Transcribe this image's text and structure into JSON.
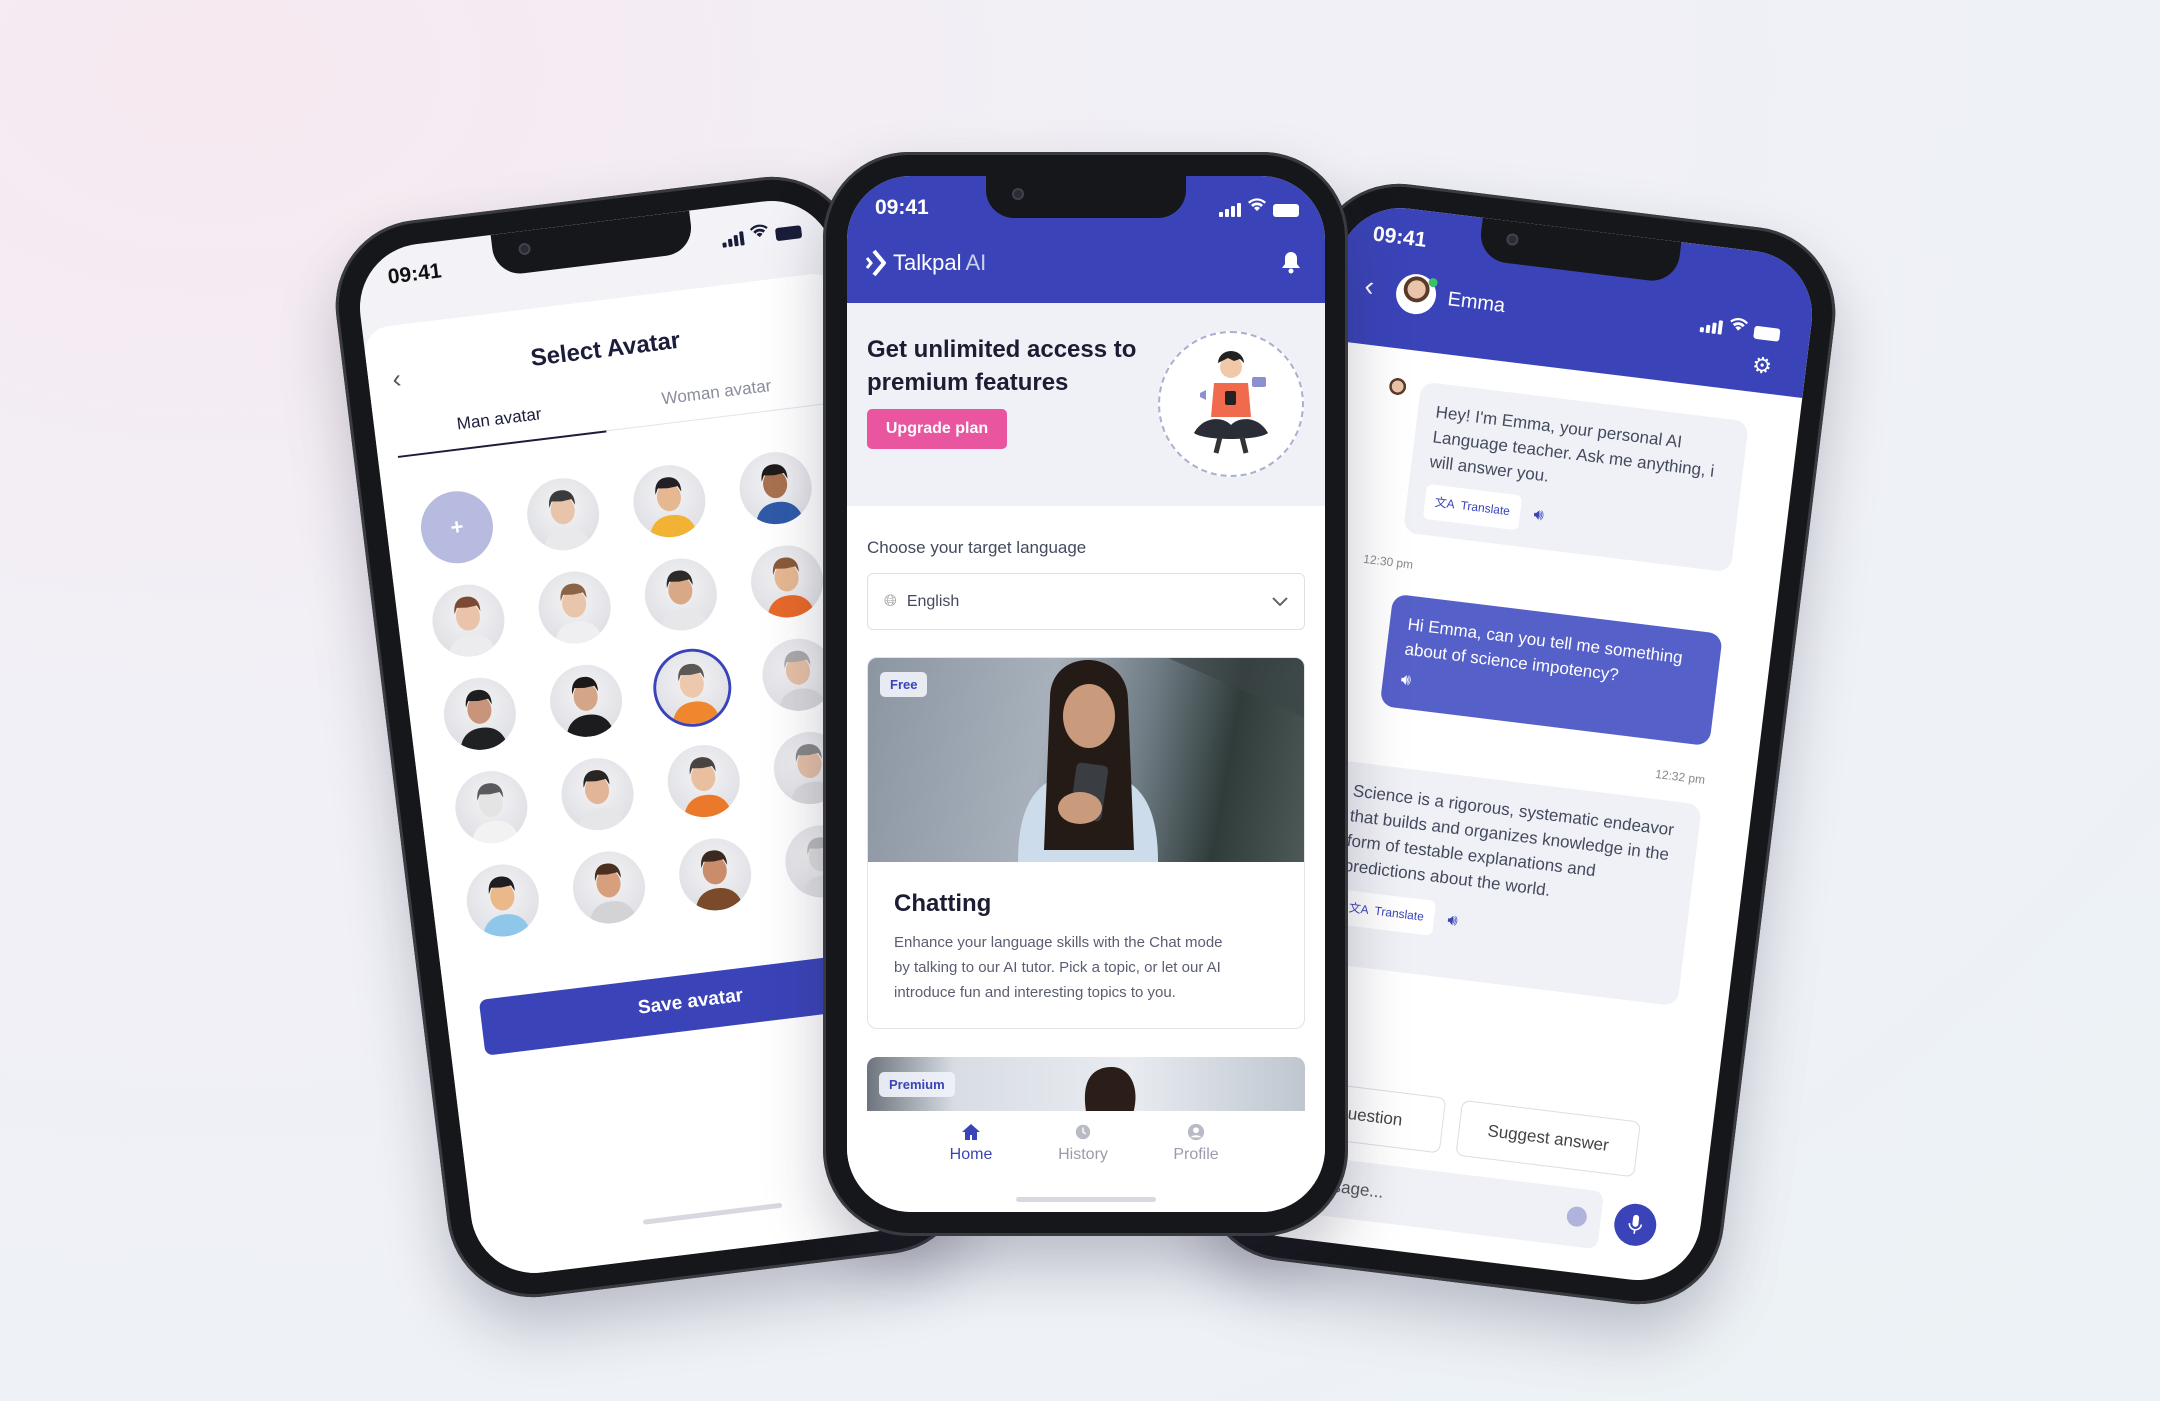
{
  "colors": {
    "brand": "#3a44b8",
    "accent_pink": "#e9559f",
    "user_bubble": "#5660c9",
    "ai_bubble": "#f0f1f6",
    "avatar_add": "#b7bbe0"
  },
  "left_phone": {
    "status_time": "09:41",
    "title": "Select Avatar",
    "tabs": [
      {
        "label": "Man avatar",
        "active": true
      },
      {
        "label": "Woman avatar",
        "active": false
      }
    ],
    "add_avatar_label": "+",
    "avatars": [
      {
        "hair": "#3b3b3e",
        "outfit": "#e9e9ec",
        "skin": "#e8c4aa"
      },
      {
        "hair": "#232025",
        "outfit": "#f2b233",
        "skin": "#e6b892"
      },
      {
        "hair": "#1f1b1b",
        "outfit": "#2f5aa8",
        "skin": "#a8704e"
      },
      {
        "hair": "#7b4a35",
        "outfit": "#ececee",
        "skin": "#eac3aa"
      },
      {
        "hair": "#8a6444",
        "outfit": "#efeff1",
        "skin": "#e9c6ab"
      },
      {
        "hair": "#2e2a28",
        "outfit": "#e7e7ea",
        "skin": "#d9a886"
      },
      {
        "hair": "#8a5a3a",
        "outfit": "#e9692a",
        "skin": "#e6b892"
      },
      {
        "hair": "#1e1e20",
        "outfit": "#202124",
        "skin": "#c8957a"
      },
      {
        "hair": "#1a1818",
        "outfit": "#1c1c1f",
        "skin": "#d4a586"
      },
      {
        "hair": "#5c5855",
        "outfit": "#f0862e",
        "skin": "#edc8ad"
      },
      {
        "hair": "#aaa",
        "outfit": "#d8d8db",
        "skin": "#e6c0a6"
      },
      {
        "hair": "#5a5a5e",
        "outfit": "#f2f2f2",
        "skin": "#e4e4e4"
      },
      {
        "hair": "#2a2525",
        "outfit": "#e6e6e8",
        "skin": "#e2b596"
      },
      {
        "hair": "#4a4440",
        "outfit": "#ea7a2a",
        "skin": "#e8c0a0"
      },
      {
        "hair": "#888",
        "outfit": "#dadadd",
        "skin": "#e3c0a8"
      },
      {
        "hair": "#1e1e22",
        "outfit": "#8fc7ea",
        "skin": "#eab889"
      },
      {
        "hair": "#4b3020",
        "outfit": "#d3d3d6",
        "skin": "#d89f7c"
      },
      {
        "hair": "#3a2a20",
        "outfit": "#7b4a2a",
        "skin": "#c98d6b"
      },
      {
        "hair": "#bbb",
        "outfit": "#e0e0e3",
        "skin": "#ddd"
      }
    ],
    "selected_avatar": 9,
    "save_label": "Save avatar"
  },
  "center_phone": {
    "status_time": "09:41",
    "logo_text": "Talkpal",
    "logo_suffix": "AI",
    "promo": {
      "title_line1": "Get unlimited access to",
      "title_line2": "premium features",
      "button": "Upgrade plan"
    },
    "language": {
      "label": "Choose your target language",
      "value": "English"
    },
    "cards": [
      {
        "badge": "Free",
        "title": "Chatting",
        "description_lines": [
          "Enhance your language skills with the Chat mode",
          "by talking to our AI tutor. Pick a topic, or let our AI",
          "introduce fun and interesting topics to you."
        ]
      },
      {
        "badge": "Premium"
      }
    ],
    "nav": [
      {
        "label": "Home",
        "icon": "home-icon",
        "active": true
      },
      {
        "label": "History",
        "icon": "history-icon",
        "active": false
      },
      {
        "label": "Profile",
        "icon": "profile-icon",
        "active": false
      }
    ]
  },
  "right_phone": {
    "status_time": "09:41",
    "contact_name": "Emma",
    "messages": [
      {
        "from": "ai",
        "text": "Hey! I'm Emma, your personal AI Language teacher. Ask me anything, i will answer you.",
        "translate": "Translate",
        "time": "12:30 pm"
      },
      {
        "from": "user",
        "text": "Hi Emma, can you tell me something about of science impotency?",
        "time": "12:32 pm"
      },
      {
        "from": "ai",
        "text": "Science is a rigorous, systematic endeavor that builds and organizes knowledge in the form of testable explanations and predictions about the world.",
        "translate": "Translate"
      }
    ],
    "suggestions": [
      "Question",
      "Suggest answer"
    ],
    "input_placeholder": "Message..."
  }
}
